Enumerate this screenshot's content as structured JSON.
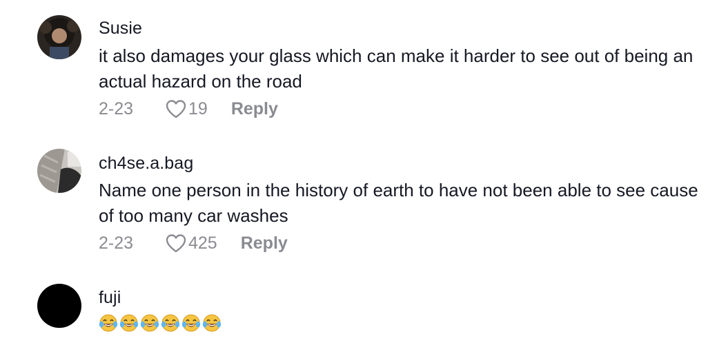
{
  "comments": [
    {
      "username": "Susie",
      "text": "it also damages your glass which can make it harder to see out of being an actual hazard on the road",
      "date": "2-23",
      "likes": "19",
      "reply_label": "Reply",
      "avatar_icon": "user-avatar-icon"
    },
    {
      "username": "ch4se.a.bag",
      "text": "Name one person in the history of earth to have not been able to see cause of too many car washes",
      "date": "2-23",
      "likes": "425",
      "reply_label": "Reply",
      "avatar_icon": "user-avatar-icon"
    },
    {
      "username": "fuji",
      "text": "😂😂😂😂😂😂",
      "avatar_icon": "user-avatar-icon"
    }
  ],
  "colors": {
    "primary_text": "#161823",
    "secondary_text": "#8a8b91",
    "background": "#ffffff"
  }
}
